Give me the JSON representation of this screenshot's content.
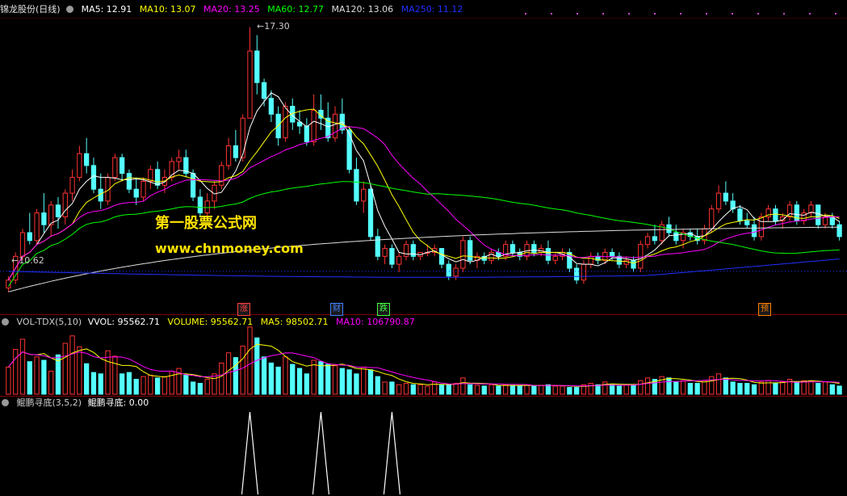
{
  "main_header": {
    "stock_name": "锦龙股份(日线)",
    "ma5": "MA5: 12.91",
    "ma10": "MA10: 13.07",
    "ma20": "MA20: 13.25",
    "ma60": "MA60: 12.77",
    "ma120": "MA120: 13.06",
    "ma250": "MA250: 11.12"
  },
  "price_labels": {
    "high": "17.30",
    "low": "10.62"
  },
  "watermark": {
    "line1": "第一股票公式网",
    "line2": "www.chnmoney.com"
  },
  "events": [
    {
      "label": "涨",
      "color": "#ff4040"
    },
    {
      "label": "财",
      "color": "#4080ff"
    },
    {
      "label": "跌",
      "color": "#40ff40"
    },
    {
      "label": "预",
      "color": "#ff8000"
    }
  ],
  "volume_header": {
    "name": "VOL-TDX(5,10)",
    "vvol": "VVOL: 95562.71",
    "volume": "VOLUME: 95562.71",
    "ma5": "MA5: 98502.71",
    "ma10": "MA10: 106790.87"
  },
  "indicator_header": {
    "name": "鲲鹏寻底(3,5,2)",
    "value": "鲲鹏寻底: 0.00"
  },
  "colors": {
    "up": "#ff3232",
    "down": "#54ffff",
    "ma5": "#ffffff",
    "ma10": "#ffff00",
    "ma20": "#ff00ff",
    "ma60": "#00ff00",
    "ma120": "#dddddd",
    "ma250": "#2030ff",
    "grid": "#800000"
  },
  "chart_data": {
    "type": "candlestick",
    "price_range": [
      10.3,
      17.5
    ],
    "volume_range": [
      0,
      100
    ],
    "candles": [
      [
        10.7,
        11.0,
        10.6,
        10.9
      ],
      [
        10.9,
        11.6,
        10.8,
        11.5
      ],
      [
        11.5,
        12.2,
        11.4,
        12.1
      ],
      [
        12.1,
        12.6,
        11.8,
        11.9
      ],
      [
        11.9,
        12.7,
        11.8,
        12.6
      ],
      [
        12.6,
        13.1,
        12.1,
        12.3
      ],
      [
        12.3,
        12.9,
        12.0,
        12.8
      ],
      [
        12.8,
        13.0,
        12.2,
        12.5
      ],
      [
        12.5,
        13.2,
        12.3,
        13.1
      ],
      [
        13.1,
        13.7,
        12.9,
        13.5
      ],
      [
        13.5,
        14.3,
        13.4,
        14.1
      ],
      [
        14.1,
        14.5,
        13.6,
        13.8
      ],
      [
        13.8,
        14.0,
        13.1,
        13.2
      ],
      [
        13.2,
        13.6,
        12.7,
        12.9
      ],
      [
        12.9,
        13.6,
        12.8,
        13.5
      ],
      [
        13.5,
        14.1,
        13.4,
        14.0
      ],
      [
        14.0,
        14.1,
        13.4,
        13.6
      ],
      [
        13.6,
        13.7,
        13.1,
        13.2
      ],
      [
        13.2,
        13.5,
        12.8,
        13.0
      ],
      [
        13.0,
        13.5,
        12.9,
        13.4
      ],
      [
        13.4,
        13.8,
        13.2,
        13.7
      ],
      [
        13.7,
        13.9,
        13.2,
        13.3
      ],
      [
        13.3,
        13.7,
        13.1,
        13.5
      ],
      [
        13.5,
        14.0,
        13.4,
        13.9
      ],
      [
        13.9,
        14.2,
        13.7,
        14.0
      ],
      [
        14.0,
        14.2,
        13.5,
        13.6
      ],
      [
        13.6,
        13.7,
        12.9,
        13.0
      ],
      [
        13.0,
        13.2,
        12.5,
        12.6
      ],
      [
        12.6,
        13.1,
        12.5,
        12.9
      ],
      [
        12.9,
        13.4,
        12.7,
        13.3
      ],
      [
        13.3,
        13.9,
        13.2,
        13.8
      ],
      [
        13.8,
        14.5,
        13.7,
        14.3
      ],
      [
        14.3,
        14.7,
        13.9,
        14.0
      ],
      [
        14.0,
        15.1,
        13.9,
        15.0
      ],
      [
        15.0,
        17.3,
        15.0,
        16.7
      ],
      [
        16.7,
        17.1,
        15.6,
        15.9
      ],
      [
        15.9,
        16.0,
        15.3,
        15.5
      ],
      [
        15.5,
        15.7,
        14.9,
        15.1
      ],
      [
        15.1,
        15.3,
        14.3,
        14.5
      ],
      [
        14.5,
        15.4,
        14.4,
        15.3
      ],
      [
        15.3,
        15.5,
        14.7,
        14.9
      ],
      [
        14.9,
        15.2,
        14.6,
        14.8
      ],
      [
        14.8,
        15.0,
        14.3,
        14.4
      ],
      [
        14.4,
        15.6,
        14.3,
        15.2
      ],
      [
        15.2,
        15.6,
        14.7,
        15.0
      ],
      [
        15.0,
        15.4,
        14.4,
        14.5
      ],
      [
        14.5,
        15.3,
        14.4,
        15.1
      ],
      [
        15.1,
        15.5,
        14.6,
        14.7
      ],
      [
        14.7,
        14.8,
        13.6,
        13.7
      ],
      [
        13.7,
        14.0,
        12.8,
        12.9
      ],
      [
        12.9,
        13.4,
        12.6,
        13.2
      ],
      [
        13.2,
        13.3,
        11.9,
        12.0
      ],
      [
        12.0,
        12.2,
        11.4,
        11.5
      ],
      [
        11.5,
        11.8,
        11.3,
        11.7
      ],
      [
        11.7,
        11.8,
        11.2,
        11.3
      ],
      [
        11.3,
        11.6,
        11.1,
        11.5
      ],
      [
        11.5,
        11.9,
        11.4,
        11.8
      ],
      [
        11.8,
        11.9,
        11.4,
        11.5
      ],
      [
        11.5,
        11.6,
        11.4,
        11.6
      ],
      [
        11.6,
        11.8,
        11.5,
        11.6
      ],
      [
        11.6,
        11.8,
        11.5,
        11.7
      ],
      [
        11.7,
        11.7,
        11.2,
        11.3
      ],
      [
        11.3,
        11.4,
        10.9,
        11.0
      ],
      [
        11.0,
        11.3,
        10.9,
        11.2
      ],
      [
        11.2,
        12.0,
        11.1,
        11.9
      ],
      [
        11.9,
        12.0,
        11.3,
        11.4
      ],
      [
        11.4,
        11.6,
        11.2,
        11.5
      ],
      [
        11.5,
        11.6,
        11.3,
        11.4
      ],
      [
        11.4,
        11.7,
        11.3,
        11.6
      ],
      [
        11.6,
        11.7,
        11.4,
        11.5
      ],
      [
        11.5,
        11.9,
        11.4,
        11.8
      ],
      [
        11.8,
        11.9,
        11.5,
        11.6
      ],
      [
        11.6,
        11.7,
        11.4,
        11.5
      ],
      [
        11.5,
        11.9,
        11.4,
        11.8
      ],
      [
        11.8,
        11.9,
        11.5,
        11.6
      ],
      [
        11.6,
        11.8,
        11.5,
        11.7
      ],
      [
        11.7,
        11.9,
        11.3,
        11.4
      ],
      [
        11.4,
        11.6,
        11.3,
        11.5
      ],
      [
        11.5,
        11.7,
        11.4,
        11.6
      ],
      [
        11.6,
        11.7,
        11.1,
        11.2
      ],
      [
        11.2,
        11.3,
        10.8,
        10.9
      ],
      [
        10.9,
        11.4,
        10.8,
        11.3
      ],
      [
        11.3,
        11.6,
        11.2,
        11.5
      ],
      [
        11.5,
        11.6,
        11.3,
        11.4
      ],
      [
        11.4,
        11.7,
        11.3,
        11.6
      ],
      [
        11.6,
        11.7,
        11.4,
        11.5
      ],
      [
        11.5,
        11.6,
        11.2,
        11.3
      ],
      [
        11.3,
        11.5,
        11.2,
        11.4
      ],
      [
        11.4,
        11.5,
        11.1,
        11.2
      ],
      [
        11.2,
        11.9,
        11.1,
        11.8
      ],
      [
        11.8,
        12.1,
        11.7,
        12.0
      ],
      [
        12.0,
        12.3,
        11.8,
        11.9
      ],
      [
        11.9,
        12.4,
        11.8,
        12.3
      ],
      [
        12.3,
        12.5,
        12.0,
        12.1
      ],
      [
        12.1,
        12.3,
        11.8,
        11.9
      ],
      [
        11.9,
        12.2,
        11.7,
        12.1
      ],
      [
        12.1,
        12.2,
        11.9,
        12.0
      ],
      [
        12.0,
        12.2,
        11.8,
        11.9
      ],
      [
        11.9,
        12.3,
        11.8,
        12.2
      ],
      [
        12.2,
        12.8,
        12.1,
        12.7
      ],
      [
        12.7,
        13.3,
        12.6,
        13.1
      ],
      [
        13.1,
        13.4,
        12.8,
        12.9
      ],
      [
        12.9,
        13.1,
        12.6,
        12.7
      ],
      [
        12.7,
        12.8,
        12.3,
        12.4
      ],
      [
        12.4,
        12.6,
        12.2,
        12.3
      ],
      [
        12.3,
        12.5,
        11.9,
        12.0
      ],
      [
        12.0,
        12.6,
        11.9,
        12.5
      ],
      [
        12.5,
        12.8,
        12.4,
        12.7
      ],
      [
        12.7,
        12.8,
        12.3,
        12.4
      ],
      [
        12.4,
        12.6,
        12.2,
        12.5
      ],
      [
        12.5,
        12.9,
        12.4,
        12.8
      ],
      [
        12.8,
        12.9,
        12.3,
        12.4
      ],
      [
        12.4,
        12.7,
        12.3,
        12.6
      ],
      [
        12.6,
        12.9,
        12.5,
        12.8
      ],
      [
        12.8,
        12.8,
        12.2,
        12.3
      ],
      [
        12.3,
        12.6,
        12.2,
        12.5
      ],
      [
        12.5,
        12.6,
        12.2,
        12.3
      ],
      [
        12.3,
        12.4,
        11.9,
        12.0
      ]
    ],
    "volume": [
      40,
      66,
      81,
      48,
      55,
      50,
      34,
      58,
      75,
      86,
      70,
      45,
      32,
      30,
      64,
      56,
      30,
      32,
      22,
      26,
      28,
      24,
      26,
      34,
      38,
      28,
      18,
      16,
      22,
      30,
      46,
      61,
      54,
      71,
      99,
      83,
      55,
      46,
      40,
      55,
      44,
      38,
      30,
      50,
      48,
      44,
      42,
      38,
      36,
      30,
      40,
      36,
      26,
      18,
      18,
      14,
      16,
      14,
      14,
      12,
      18,
      14,
      14,
      16,
      24,
      14,
      13,
      12,
      14,
      12,
      14,
      13,
      12,
      14,
      12,
      13,
      14,
      12,
      12,
      10,
      10,
      14,
      16,
      14,
      18,
      14,
      12,
      14,
      14,
      20,
      24,
      22,
      26,
      24,
      18,
      20,
      16,
      16,
      20,
      26,
      30,
      24,
      18,
      16,
      16,
      14,
      18,
      20,
      16,
      18,
      22,
      18,
      20,
      20,
      16,
      18,
      14,
      12
    ],
    "indicator_signals": [
      34,
      44,
      54
    ]
  }
}
